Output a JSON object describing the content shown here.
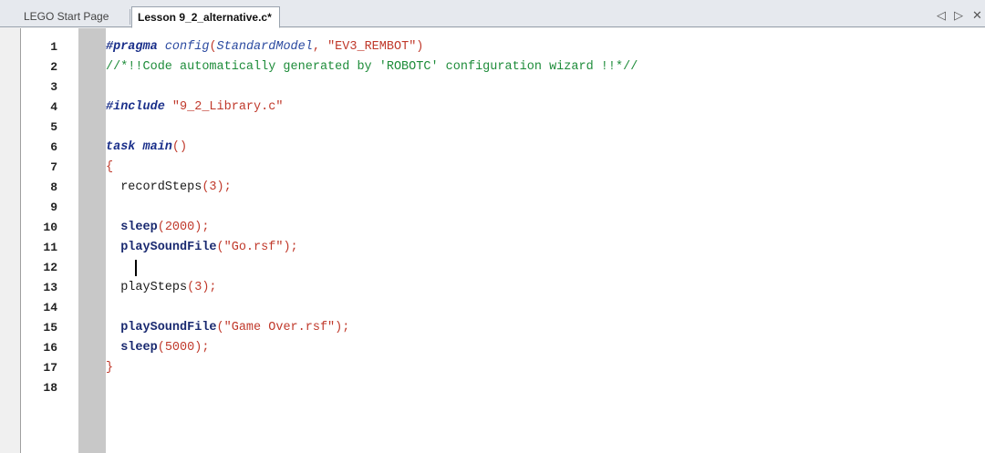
{
  "tabs": {
    "start_page": "LEGO Start Page",
    "active_file": "Lesson 9_2_alternative.c*",
    "nav_prev": "◁",
    "nav_next": "▷",
    "close": "✕"
  },
  "editor": {
    "cursor_line": 12,
    "line_numbers": [
      "1",
      "2",
      "3",
      "4",
      "5",
      "6",
      "7",
      "8",
      "9",
      "10",
      "11",
      "12",
      "13",
      "14",
      "15",
      "16",
      "17",
      "18"
    ],
    "code": {
      "l1_pragma": "#pragma",
      "l1_config": "config",
      "l1_open": "(",
      "l1_model": "StandardModel",
      "l1_comma": ", ",
      "l1_str": "\"EV3_REMBOT\"",
      "l1_close": ")",
      "l2_comment": "//*!!Code automatically generated by 'ROBOTC' configuration wizard !!*//",
      "l4_include": "#include",
      "l4_str": " \"9_2_Library.c\"",
      "l6_task": "task",
      "l6_main": " main",
      "l6_paren": "()",
      "l7_brace": "{",
      "l8_fn": "  recordSteps",
      "l8_args": "(3);",
      "l10_fn": "  sleep",
      "l10_args": "(2000);",
      "l11_fn": "  playSoundFile",
      "l11_args": "(\"Go.rsf\");",
      "l13_fn": "  playSteps",
      "l13_args": "(3);",
      "l15_fn": "  playSoundFile",
      "l15_args": "(\"Game Over.rsf\");",
      "l16_fn": "  sleep",
      "l16_args": "(5000);",
      "l17_brace": "}"
    }
  }
}
